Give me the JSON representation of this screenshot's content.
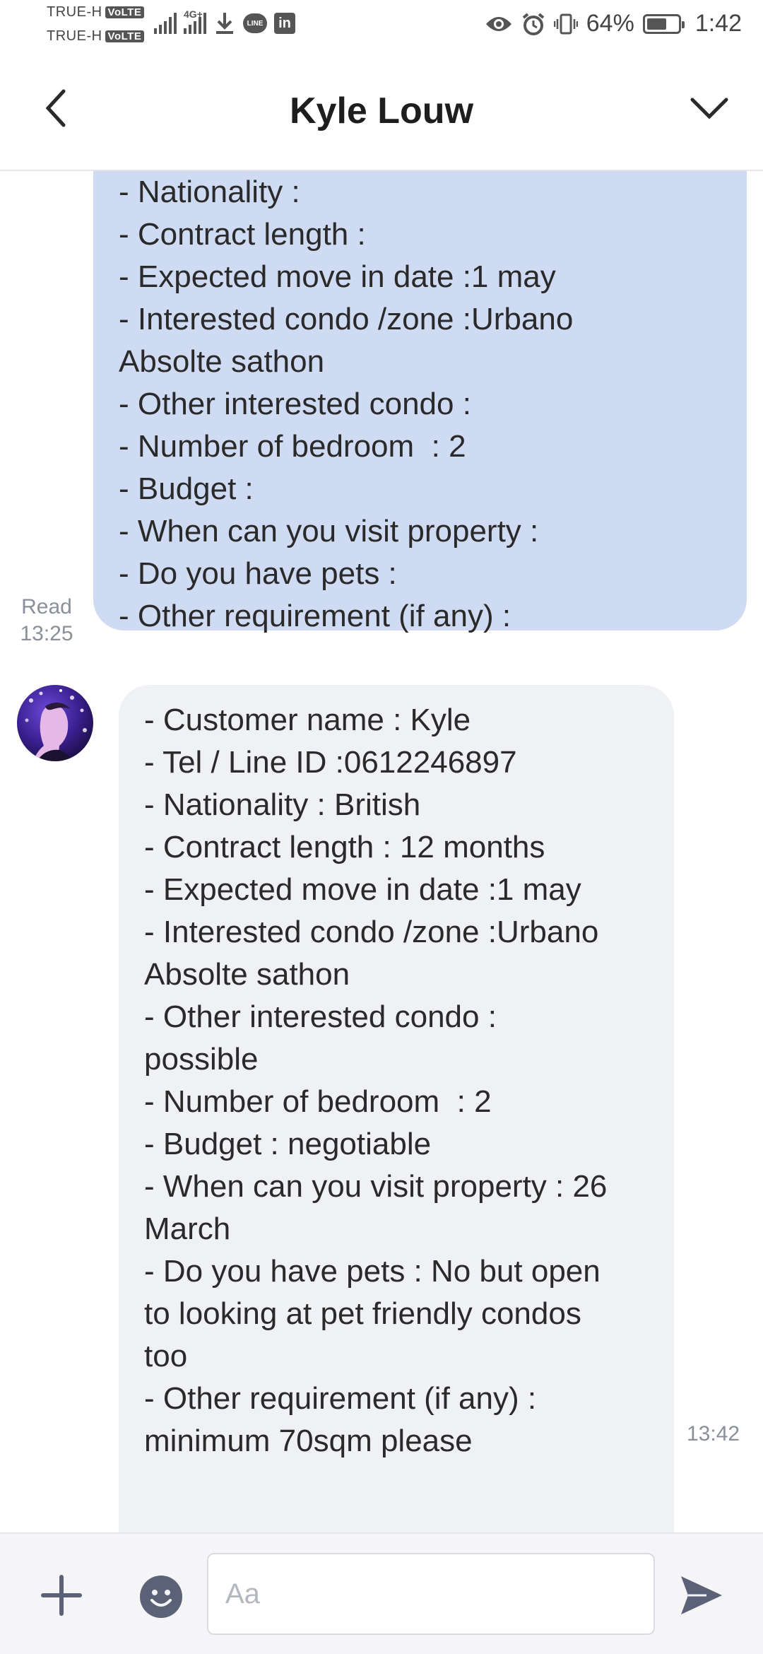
{
  "status_bar": {
    "carrier1": "TRUE-H",
    "carrier2": "TRUE-H",
    "volte": "VoLTE",
    "network": "4G+",
    "line_badge": "LINE",
    "linkedin_badge": "in",
    "battery_percent": "64%",
    "battery_level": 0.64,
    "time": "1:42"
  },
  "header": {
    "title": "Kyle Louw"
  },
  "messages": {
    "outgoing": {
      "lines": [
        "- Nationality :",
        "- Contract length :",
        "- Expected move in date :1 may",
        "- Interested condo /zone :Urbano",
        "Absolte sathon",
        "- Other interested condo :",
        "- Number of bedroom  : 2",
        "- Budget :",
        "- When can you visit property :",
        "- Do you have pets :",
        "- Other requirement (if any) :"
      ],
      "status": "Read",
      "time": "13:25"
    },
    "incoming": {
      "lines": [
        "- Customer name : Kyle",
        "- Tel / Line ID :0612246897",
        "- Nationality : British",
        "- Contract length : 12 months",
        "- Expected move in date :1 may",
        "- Interested condo /zone :Urbano",
        "Absolte sathon",
        "- Other interested condo :",
        "possible",
        "- Number of bedroom  : 2",
        "- Budget : negotiable",
        "- When can you visit property : 26",
        "March",
        "- Do you have pets : No but open",
        "to looking at pet friendly condos",
        "too",
        "- Other requirement (if any) :",
        "minimum 70sqm please"
      ],
      "time": "13:42"
    }
  },
  "composer": {
    "placeholder": "Aa"
  },
  "colors": {
    "outgoing_bubble": "#cfdaf3",
    "incoming_bubble": "#f0f1f4",
    "icon": "#5b6177"
  },
  "icons": {
    "back": "chevron-left-icon",
    "menu": "chevron-down-icon",
    "plus": "plus-icon",
    "emoji": "emoji-icon",
    "send": "send-icon"
  }
}
